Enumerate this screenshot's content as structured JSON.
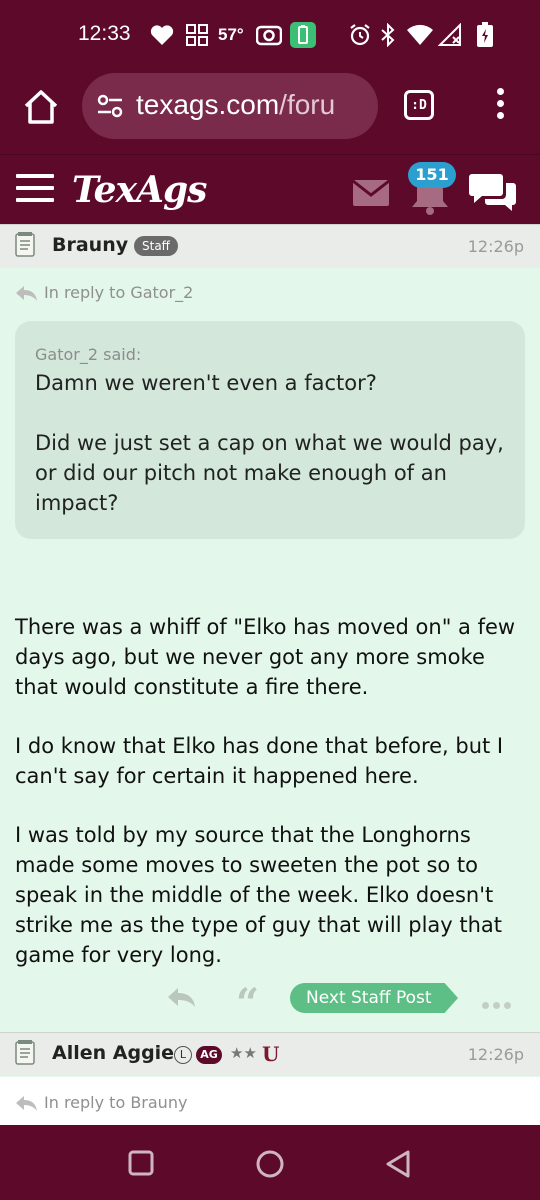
{
  "status_bar": {
    "time": "12:33",
    "temperature": "57°",
    "icons": [
      "heart-icon",
      "grid-icon",
      "camera-icon",
      "battery-saver-icon",
      "alarm-icon",
      "bluetooth-icon",
      "wifi-icon",
      "signal-icon",
      "battery-icon"
    ]
  },
  "browser": {
    "url_domain": "texags.com",
    "url_path": "/foru",
    "tab_label": ":D"
  },
  "site": {
    "logo": "TexAgs",
    "notification_count": "151"
  },
  "post": {
    "author": "Brauny",
    "badge": "Staff",
    "time": "12:26p",
    "reply_to": "In reply to Gator_2",
    "quote_author": "Gator_2 said:",
    "quote_text": "Damn we weren't even a factor?\n\nDid we just set a cap on what we would pay, or did our pitch not make enough of an impact?",
    "body": [
      "There was a whiff of \"Elko has moved on\" a few days ago, but we never got any more smoke that would constitute a fire there.",
      "I do know that Elko has done that before, but I can't say for certain it happened here.",
      "I was told by my source that the Longhorns made some moves to sweeten the pot so to speak in the middle of the week. Elko doesn't strike me as the type of guy that will play that game for very long."
    ],
    "next_staff_label": "Next Staff Post"
  },
  "post2": {
    "author": "Allen Aggie",
    "license_badge": "L",
    "ag_badge": "AG",
    "stars": "★★",
    "school_logo": "U",
    "time": "12:26p",
    "reply_to": "In reply to Brauny"
  },
  "colors": {
    "maroon": "#5d0a2a",
    "post_bg": "#e3f7ea",
    "accent_green": "#5dbf86",
    "badge_blue": "#2b9fd0"
  }
}
